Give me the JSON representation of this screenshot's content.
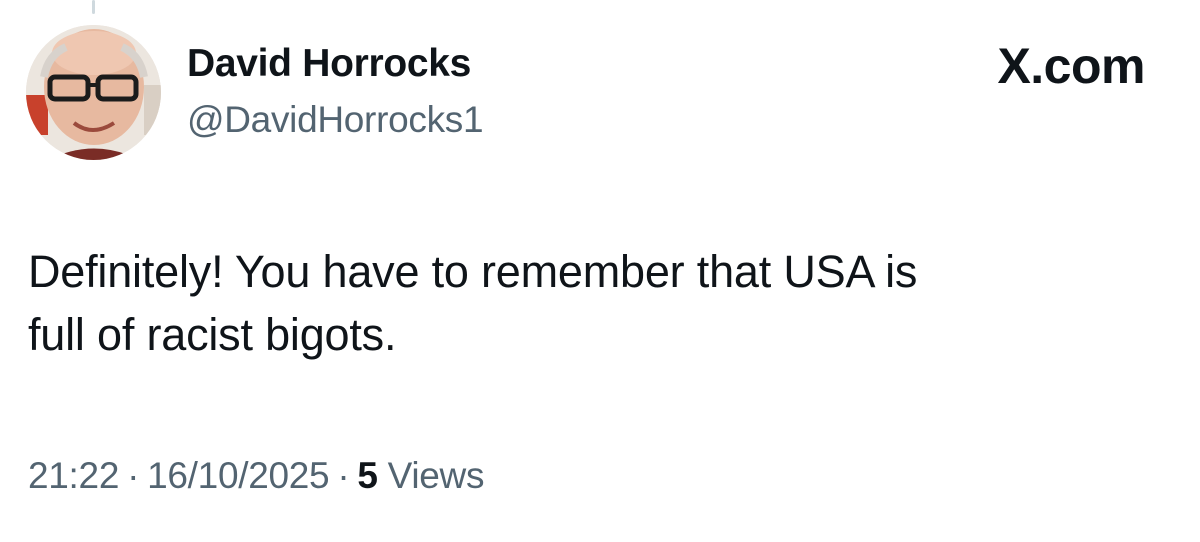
{
  "author": {
    "display_name": "David Horrocks",
    "handle": "@DavidHorrocks1"
  },
  "brand": {
    "label": "X.com"
  },
  "tweet": {
    "lines": [
      "Definitely! You have to remember that USA is",
      "full of racist bigots."
    ]
  },
  "meta": {
    "time": "21:22",
    "separator": "·",
    "date": "16/10/2025",
    "views_count": "5",
    "views_label": "Views"
  },
  "colors": {
    "text_primary": "#0f1419",
    "text_secondary": "#536471",
    "thread_line": "#cfd9de",
    "background": "#ffffff"
  }
}
